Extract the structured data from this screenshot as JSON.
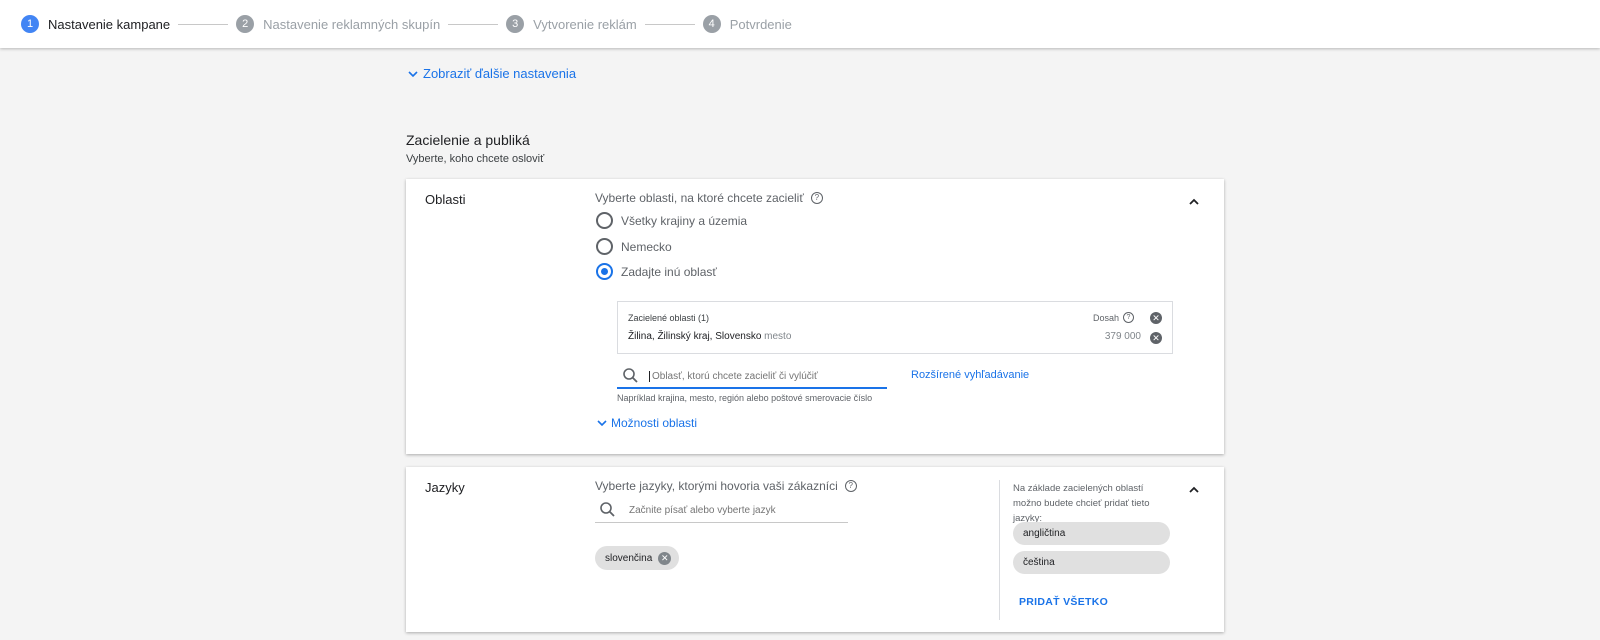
{
  "stepper": {
    "steps": [
      {
        "num": "1",
        "label": "Nastavenie kampane"
      },
      {
        "num": "2",
        "label": "Nastavenie reklamných skupín"
      },
      {
        "num": "3",
        "label": "Vytvorenie reklám"
      },
      {
        "num": "4",
        "label": "Potvrdenie"
      }
    ]
  },
  "more_settings": "Zobraziť ďalšie nastavenia",
  "section": {
    "title": "Zacielenie a publiká",
    "subtitle": "Vyberte, koho chcete osloviť"
  },
  "oblasti": {
    "title": "Oblasti",
    "prompt": "Vyberte oblasti, na ktoré chcete zacieliť",
    "help_glyph": "?",
    "options": [
      {
        "label": "Všetky krajiny a územia",
        "checked": false
      },
      {
        "label": "Nemecko",
        "checked": false
      },
      {
        "label": "Zadajte inú oblasť",
        "checked": true
      }
    ],
    "targeted_header": "Zacielené oblasti (1)",
    "reach_label": "Dosah",
    "location": {
      "name": "Žilina, Žilinský kraj, Slovensko",
      "type": "mesto",
      "reach": "379 000"
    },
    "search_placeholder": "Oblasť, ktorú chcete zacieliť či vylúčiť",
    "advanced_search": "Rozšírené vyhľadávanie",
    "hint": "Napríklad krajina, mesto, región alebo poštové smerovacie číslo",
    "more_options": "Možnosti oblasti"
  },
  "jazyky": {
    "title": "Jazyky",
    "prompt": "Vyberte jazyky, ktorými hovoria vaši zákazníci",
    "search_placeholder": "Začnite písať alebo vyberte jazyk",
    "selected": [
      "slovenčina"
    ],
    "suggest_text": "Na základe zacielených oblastí možno budete chcieť pridať tieto jazyky:",
    "suggestions": [
      "angličtina",
      "čeština"
    ],
    "add_all": "PRIDAŤ VŠETKO"
  },
  "colors": {
    "accent": "#1a73e8",
    "step_active": "#4285f4",
    "step_inactive": "#9aa0a6"
  },
  "icons": [
    "chevron-down-icon",
    "chevron-up-icon",
    "help-icon",
    "search-icon",
    "close-circle-icon"
  ]
}
